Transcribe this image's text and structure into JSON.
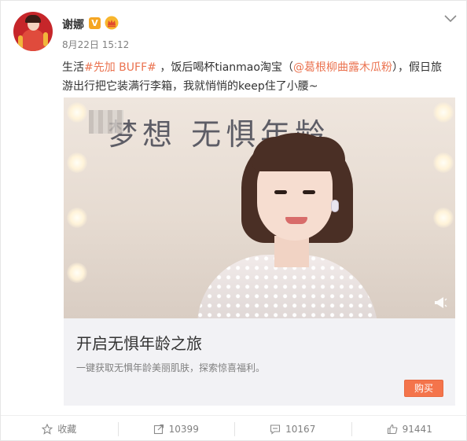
{
  "header": {
    "username": "谢娜",
    "verified_badge": "V",
    "crown_icon": "vip-crown-icon",
    "timestamp": "8月22日 15:12",
    "menu_icon": "chevron-down-icon"
  },
  "post": {
    "text_1": "生活",
    "topic": "#先加 BUFF#",
    "text_2": " ，饭后喝杯tianmao淘宝（",
    "mention": "@葛根柳曲露木瓜粉",
    "text_3": "），假日旅游出行把它装满行李箱，我就悄悄的keep住了小腰~"
  },
  "media": {
    "handwriting": "梦想 无惧年龄",
    "corner_icon": "megaphone-icon"
  },
  "promo": {
    "title": "开启无惧年龄之旅",
    "description": "一键获取无惧年龄美丽肌肤，探索惊喜福利。",
    "button_label": "购买"
  },
  "actions": {
    "favorite_label": "收藏",
    "repost_count": "10399",
    "comment_count": "10167",
    "like_count": "91441"
  },
  "colors": {
    "link": "#eb7350",
    "buy_button": "#f4744b",
    "badge": "#f5a623"
  }
}
